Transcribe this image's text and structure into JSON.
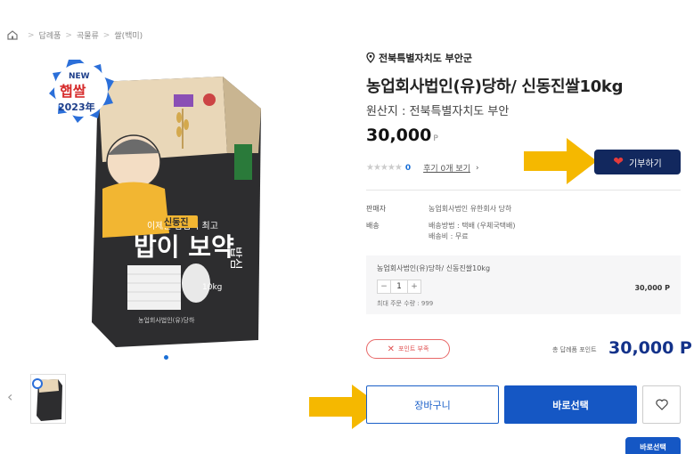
{
  "breadcrumb": {
    "home_icon": "home-icon",
    "items": [
      "답례품",
      "곡물류",
      "쌀(백미)"
    ]
  },
  "product": {
    "region": "전북특별자치도 부안군",
    "title": "농업회사법인(유)당하/ 신동진쌀10kg",
    "origin": "원산지 : 전북특별자치도 부안",
    "price": "30,000",
    "price_unit": "P",
    "rating_count": "0",
    "review_link": "후기 0개 보기",
    "image": {
      "badge_line1": "NEW",
      "badge_line2": "햅쌀",
      "badge_line3": "2023年",
      "bag_title_small": "신동진",
      "bag_title_main": "밥이 보약",
      "bag_weight": "10kg"
    }
  },
  "donate_button": "기부하기",
  "info": {
    "seller_label": "판매자",
    "seller_value": "농업회사법인 유한회사 당하",
    "shipping_label": "배송",
    "shipping_method": "배송방법 : 택배 (우체국택배)",
    "shipping_fee": "배송비 : 무료"
  },
  "option": {
    "name": "농업회사법인(유)당하/ 신동진쌀10kg",
    "quantity": "1",
    "minus": "−",
    "plus": "+",
    "price": "30,000 P",
    "max_order": "최대 주문 수량 : 999"
  },
  "point_badge": "포인트 부족",
  "total": {
    "label": "총 답례품 포인트",
    "value": "30,000 P"
  },
  "buttons": {
    "cart": "장바구니",
    "buy": "바로선택",
    "buy_secondary": "바로선택"
  },
  "colors": {
    "primary_blue": "#1557c4",
    "navy": "#12285e",
    "total_blue": "#13328a",
    "alert_red": "#e05252",
    "annotation_arrow": "#f5b800"
  },
  "icons": [
    "home-icon",
    "location-pin-icon",
    "heart-icon",
    "chevron-left-icon",
    "chevron-right-icon",
    "close-icon"
  ]
}
